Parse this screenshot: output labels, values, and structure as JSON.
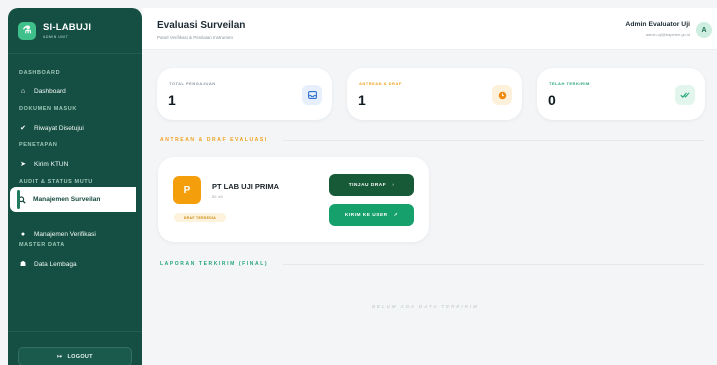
{
  "colors": {
    "sidebar": "#154f43",
    "accent": "#f59e0b",
    "green": "#1f9a6a"
  },
  "sidebar": {
    "brand_title": "SI-LABUJI",
    "brand_sub": "ADMIN UNIT",
    "sections": {
      "dashboard": "DASHBOARD",
      "dokumen": "DOKUMEN MASUK",
      "penetapan": "PENETAPAN",
      "audit": "AUDIT & STATUS MUTU",
      "master": "MASTER DATA"
    },
    "items": {
      "dashboard": "Dashboard",
      "riwayat": "Riwayat Disetujui",
      "kirim_ktun": "Kirim KTUN",
      "manajemen_surveilan": "Manajemen Surveilan",
      "manajemen_verifikasi": "Manajemen Verifikasi",
      "data_lembaga": "Data Lembaga"
    },
    "logout": "LOGOUT"
  },
  "header": {
    "title": "Evaluasi Surveilan",
    "subtitle": "Panel Verifikasi & Penilaian Instrumen",
    "user_name": "Admin Evaluator Uji",
    "user_email": "admin.uji@bapeten.go.id",
    "avatar_letter": "A"
  },
  "stats": [
    {
      "label": "TOTAL PENGAJUAN",
      "value": "1",
      "icon": "inbox-icon"
    },
    {
      "label": "ANTREAN & DRAF",
      "value": "1",
      "icon": "clock-icon"
    },
    {
      "label": "TELAH TERKIRIM",
      "value": "0",
      "icon": "check-double-icon"
    }
  ],
  "antrean": {
    "heading": "ANTREAN & DRAF EVALUASI",
    "item": {
      "badge": "P",
      "name": "PT LAB UJI PRIMA",
      "id": "ID: #4",
      "status": "DRAF TERSEDIA",
      "btn_review": "TINJAU DRAF",
      "btn_send": "KIRIM KE USER"
    }
  },
  "laporan": {
    "heading": "LAPORAN TERKIRIM (FINAL)",
    "empty": "BELUM ADA DATA TERKIRIM"
  }
}
